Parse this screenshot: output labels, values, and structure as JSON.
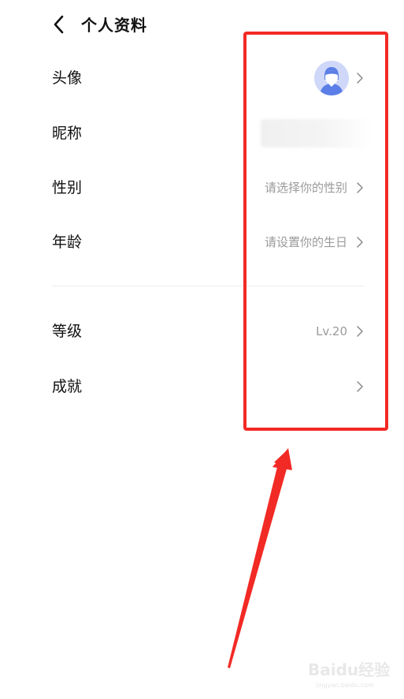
{
  "header": {
    "title": "个人资料",
    "back_icon": "chevron-left-icon"
  },
  "rows": [
    {
      "id": "avatar",
      "label": "头像",
      "value": "",
      "type": "avatar"
    },
    {
      "id": "nickname",
      "label": "昵称",
      "value": "",
      "type": "blurred"
    },
    {
      "id": "gender",
      "label": "性别",
      "value": "请选择你的性别",
      "type": "text"
    },
    {
      "id": "age",
      "label": "年龄",
      "value": "请设置你的生日",
      "type": "text"
    },
    {
      "id": "level",
      "label": "等级",
      "value": "Lv.20",
      "type": "text"
    },
    {
      "id": "achievement",
      "label": "成就",
      "value": "",
      "type": "text"
    }
  ],
  "annotation": {
    "box_color": "#f22a25",
    "arrow_color": "#f22a25"
  },
  "watermark": {
    "main": "Baidu经验",
    "sub": "jingyan.baidu.com"
  },
  "colors": {
    "text_primary": "#111111",
    "text_secondary": "#9a9a9a",
    "divider": "#ececec",
    "avatar_bg": "#cfd8f8",
    "avatar_fg": "#5b7fe6"
  }
}
